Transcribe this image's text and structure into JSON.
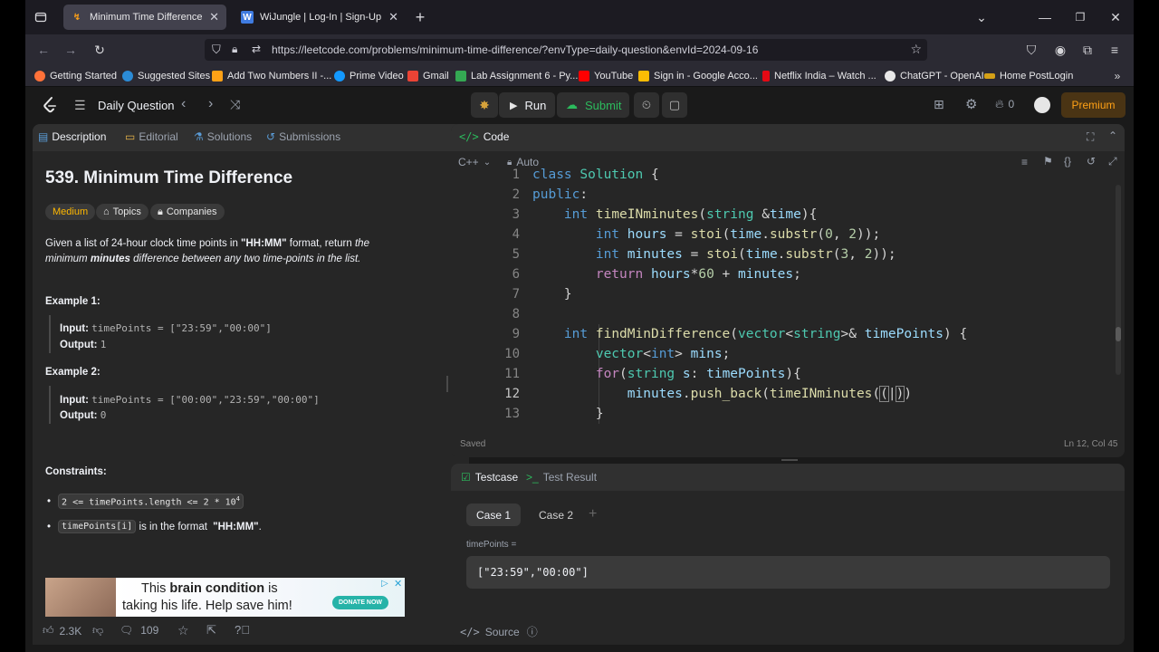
{
  "browser": {
    "tabs": [
      {
        "title": "Minimum Time Difference - Lee",
        "favicon": "leetcode-icon",
        "active": true
      },
      {
        "title": "WiJungle | Log-In | Sign-Up",
        "favicon": "W",
        "active": false
      }
    ],
    "url": "https://leetcode.com/problems/minimum-time-difference/?envType=daily-question&envId=2024-09-16",
    "bookmarks": [
      {
        "label": "Getting Started",
        "color": "#ff7139"
      },
      {
        "label": "Suggested Sites",
        "color": "#2b8bd6"
      },
      {
        "label": "Add Two Numbers II -...",
        "color": "#ffa116"
      },
      {
        "label": "Prime Video",
        "color": "#1399ff"
      },
      {
        "label": "Gmail",
        "color": "#ea4335"
      },
      {
        "label": "Lab Assignment 6 - Py...",
        "color": "#34a853"
      },
      {
        "label": "YouTube",
        "color": "#ff0000"
      },
      {
        "label": "Sign in - Google Acco...",
        "color": "#fbbc04"
      },
      {
        "label": "Netflix India – Watch ...",
        "color": "#e50914"
      },
      {
        "label": "ChatGPT - OpenAI",
        "color": "#e8e8e8"
      },
      {
        "label": "Home PostLogin",
        "color": "#d4a017"
      }
    ]
  },
  "header": {
    "nav_title": "Daily Question",
    "run_label": "Run",
    "submit_label": "Submit",
    "streak_count": "0",
    "premium_label": "Premium"
  },
  "left_tabs": [
    "Description",
    "Editorial",
    "Solutions",
    "Submissions"
  ],
  "problem": {
    "title": "539. Minimum Time Difference",
    "difficulty": "Medium",
    "topics_label": "Topics",
    "companies_label": "Companies",
    "desc_1": "Given a list of 24-hour clock time points in ",
    "desc_bold": "\"HH:MM\"",
    "desc_2": " format, return ",
    "desc_italic_1": "the",
    "desc_italic_2": "minimum ",
    "desc_bold_italic": "minutes",
    "desc_italic_3": " difference between any two time-points in the list.",
    "example1_title": "Example 1:",
    "example1_input_label": "Input:",
    "example1_input": "timePoints = [\"23:59\",\"00:00\"]",
    "example1_output_label": "Output:",
    "example1_output": "1",
    "example2_title": "Example 2:",
    "example2_input_label": "Input:",
    "example2_input": "timePoints = [\"00:00\",\"23:59\",\"00:00\"]",
    "example2_output_label": "Output:",
    "example2_output": "0",
    "constraints_title": "Constraints:",
    "constraint1_code": "2 <= timePoints.length <= 2 * 10",
    "constraint1_sup": "4",
    "constraint2_code": "timePoints[i]",
    "constraint2_text": " is in the format ",
    "constraint2_bold": "\"HH:MM\"",
    "constraint2_end": "."
  },
  "ad": {
    "line1_pre": "This ",
    "line1_bold": "brain condition",
    "line1_post": " is",
    "line2": "taking his life. Help save him!",
    "button": "DONATE NOW"
  },
  "footer_left": {
    "likes": "2.3K",
    "comments": "109"
  },
  "code_panel": {
    "title": "Code",
    "language": "C++",
    "mode": "Auto",
    "line_numbers": [
      "1",
      "2",
      "3",
      "4",
      "5",
      "6",
      "7",
      "8",
      "9",
      "10",
      "11",
      "12",
      "13"
    ],
    "status": "Saved",
    "cursor": "Ln 12, Col 45"
  },
  "testcase": {
    "tab1": "Testcase",
    "tab2": "Test Result",
    "case1": "Case 1",
    "case2": "Case 2",
    "param_label": "timePoints =",
    "param_value": "[\"23:59\",\"00:00\"]",
    "source_label": "Source"
  }
}
